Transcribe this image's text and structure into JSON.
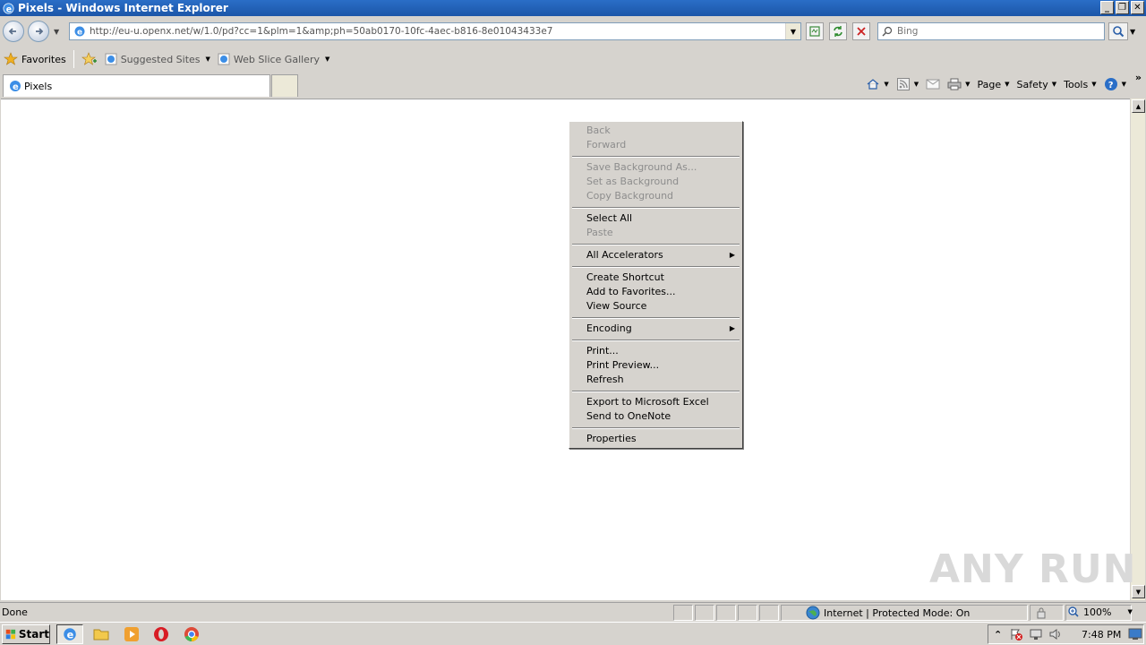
{
  "window": {
    "title": "Pixels - Windows Internet Explorer",
    "buttons": {
      "minimize": "_",
      "maximize": "❐",
      "close": "✕"
    }
  },
  "address_bar": {
    "url": "http://eu-u.openx.net/w/1.0/pd?cc=1&plm=1&amp;ph=50ab0170-10fc-4aec-b816-8e01043433e7"
  },
  "search": {
    "placeholder": "Bing"
  },
  "favorites_bar": {
    "favorites_label": "Favorites",
    "items": [
      {
        "label": "Suggested Sites"
      },
      {
        "label": "Web Slice Gallery"
      }
    ]
  },
  "tabs": [
    {
      "label": "Pixels"
    }
  ],
  "command_bar": {
    "page": "Page",
    "safety": "Safety",
    "tools": "Tools",
    "more": "»"
  },
  "context_menu": {
    "groups": [
      [
        {
          "label": "Back",
          "enabled": false
        },
        {
          "label": "Forward",
          "enabled": false
        }
      ],
      [
        {
          "label": "Save Background As...",
          "enabled": false
        },
        {
          "label": "Set as Background",
          "enabled": false
        },
        {
          "label": "Copy Background",
          "enabled": false
        }
      ],
      [
        {
          "label": "Select All",
          "enabled": true
        },
        {
          "label": "Paste",
          "enabled": false
        }
      ],
      [
        {
          "label": "All Accelerators",
          "enabled": true,
          "submenu": true
        }
      ],
      [
        {
          "label": "Create Shortcut",
          "enabled": true
        },
        {
          "label": "Add to Favorites...",
          "enabled": true
        },
        {
          "label": "View Source",
          "enabled": true
        }
      ],
      [
        {
          "label": "Encoding",
          "enabled": true,
          "submenu": true
        }
      ],
      [
        {
          "label": "Print...",
          "enabled": true
        },
        {
          "label": "Print Preview...",
          "enabled": true
        },
        {
          "label": "Refresh",
          "enabled": true
        }
      ],
      [
        {
          "label": "Export to Microsoft Excel",
          "enabled": true
        },
        {
          "label": "Send to OneNote",
          "enabled": true
        }
      ],
      [
        {
          "label": "Properties",
          "enabled": true
        }
      ]
    ]
  },
  "watermark": "ANY RUN",
  "status_bar": {
    "status": "Done",
    "zone": "Internet | Protected Mode: On",
    "zoom": "100%"
  },
  "taskbar": {
    "start_label": "Start",
    "clock": "7:48 PM",
    "apps": [
      "internet-explorer-icon",
      "folder-icon",
      "media-player-icon",
      "opera-icon",
      "chrome-icon"
    ]
  },
  "colors": {
    "titlebar": "#1c56a8",
    "chrome": "#d6d3ce",
    "disabled_text": "#8d8d8d"
  }
}
